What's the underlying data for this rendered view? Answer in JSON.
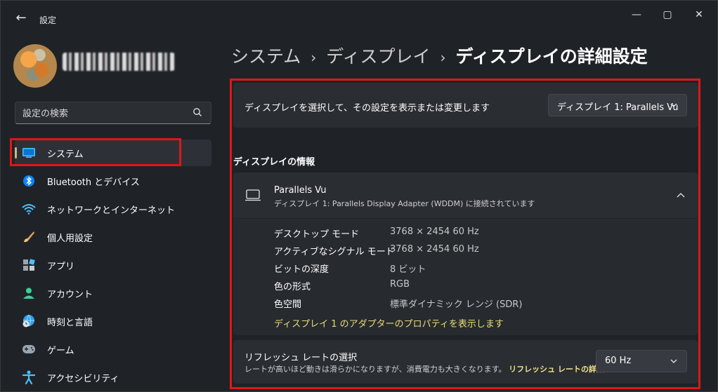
{
  "window": {
    "title": "設定",
    "controls": {
      "minimize": "—",
      "maximize": "▢",
      "close": "✕"
    }
  },
  "search": {
    "placeholder": "設定の検索"
  },
  "sidebar": {
    "items": [
      {
        "label": "システム",
        "icon": "system-monitor-icon",
        "active": true
      },
      {
        "label": "Bluetooth とデバイス",
        "icon": "bluetooth-icon"
      },
      {
        "label": "ネットワークとインターネット",
        "icon": "wifi-icon"
      },
      {
        "label": "個人用設定",
        "icon": "brush-icon"
      },
      {
        "label": "アプリ",
        "icon": "apps-icon"
      },
      {
        "label": "アカウント",
        "icon": "account-icon"
      },
      {
        "label": "時刻と言語",
        "icon": "globe-clock-icon"
      },
      {
        "label": "ゲーム",
        "icon": "gamepad-icon"
      },
      {
        "label": "アクセシビリティ",
        "icon": "accessibility-icon"
      }
    ]
  },
  "breadcrumb": {
    "items": [
      "システム",
      "ディスプレイ",
      "ディスプレイの詳細設定"
    ],
    "separator": "›"
  },
  "select_display": {
    "label": "ディスプレイを選択して、その設定を表示または変更します",
    "value": "ディスプレイ 1: Parallels Vu"
  },
  "display_info": {
    "section_title": "ディスプレイの情報",
    "name": "Parallels Vu",
    "subtitle": "ディスプレイ 1: Parallels Display Adapter (WDDM) に接続されています",
    "rows": [
      {
        "key": "デスクトップ モード",
        "value": "3768 × 2454 60 Hz"
      },
      {
        "key": "アクティブなシグナル モード",
        "value": "3768 × 2454 60 Hz"
      },
      {
        "key": "ビットの深度",
        "value": "8 ビット"
      },
      {
        "key": "色の形式",
        "value": "RGB"
      },
      {
        "key": "色空間",
        "value": "標準ダイナミック レンジ (SDR)"
      }
    ],
    "adapter_link": "ディスプレイ 1 のアダプターのプロパティを表示します"
  },
  "refresh": {
    "title": "リフレッシュ レートの選択",
    "description": "レートが高いほど動きは滑らかになりますが、消費電力も大きくなります。",
    "details_link": "リフレッシュ レートの詳細",
    "value": "60 Hz"
  },
  "colors": {
    "highlight": "#e01616",
    "accent": "#d0b87a",
    "link": "#e8dc7a"
  }
}
